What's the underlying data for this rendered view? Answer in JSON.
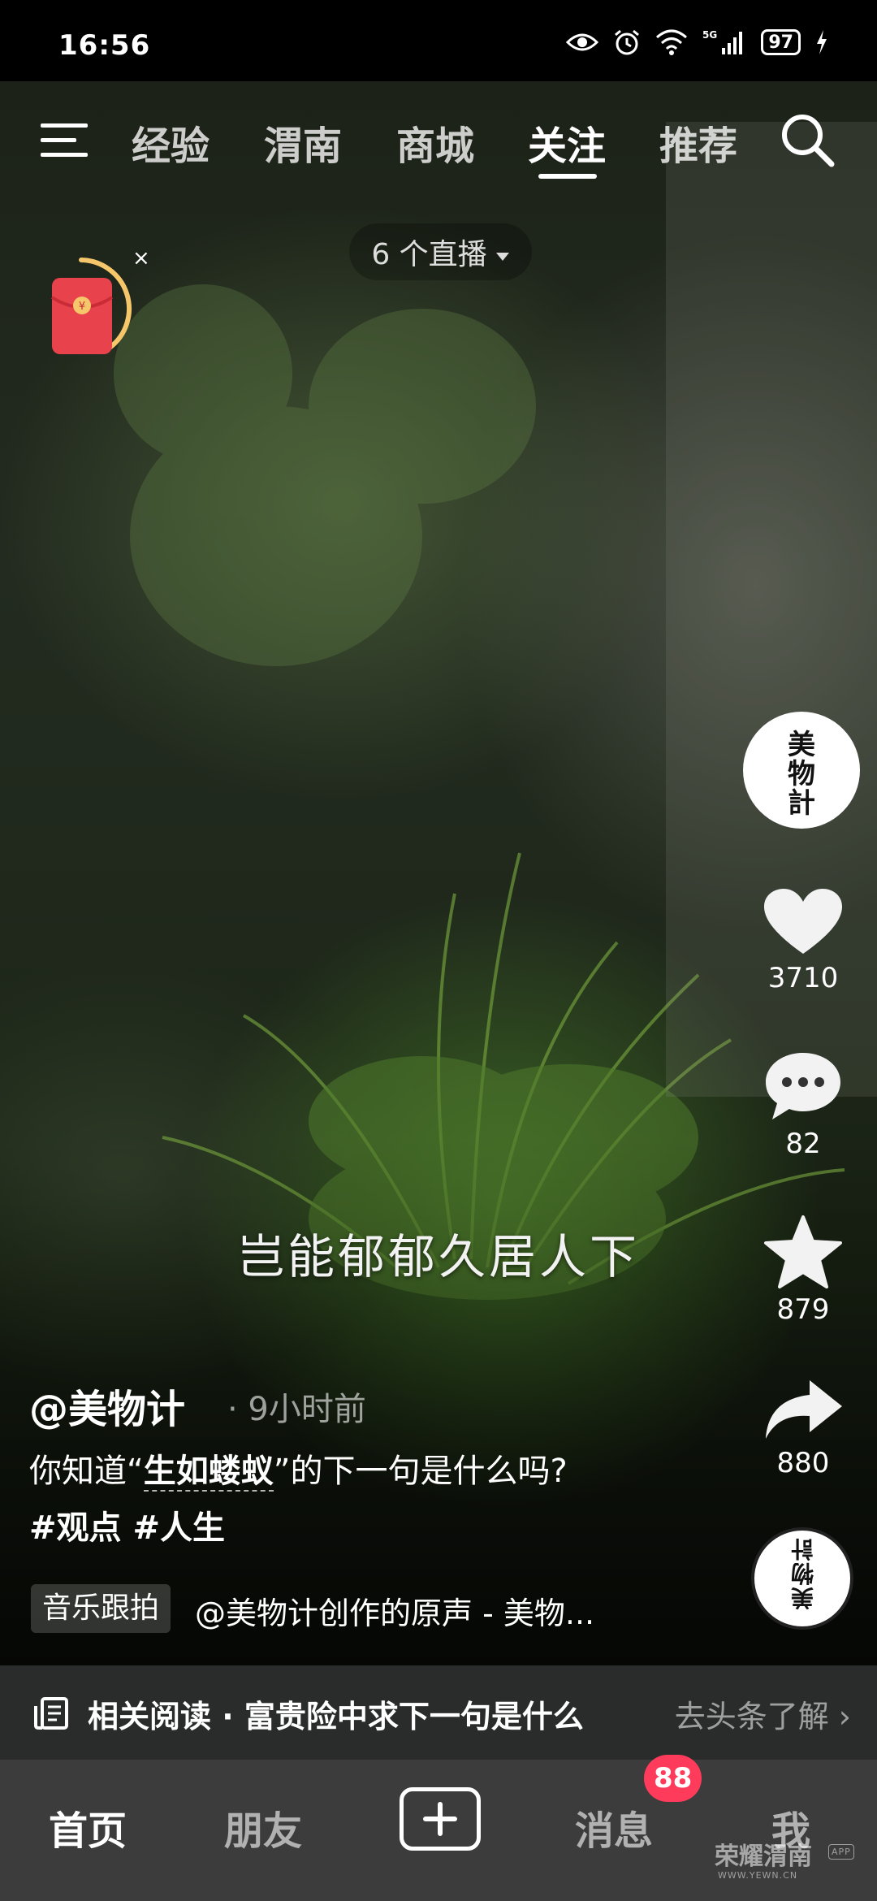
{
  "status_bar": {
    "time": "16:56",
    "network": "5G",
    "battery": "97",
    "icons": [
      "eye-icon",
      "alarm-icon",
      "wifi-icon",
      "signal-icon",
      "battery-icon",
      "charging-icon"
    ]
  },
  "top_nav": {
    "tabs": [
      {
        "label": "经验"
      },
      {
        "label": "渭南"
      },
      {
        "label": "商城"
      },
      {
        "label": "关注"
      },
      {
        "label": "推荐"
      }
    ],
    "active_tab": "关注",
    "live_pill": "6 个直播"
  },
  "video": {
    "subtitle": "岂能郁郁久居人下",
    "author": "@美物计",
    "time_ago": "· 9小时前",
    "description_prefix": "你知道“",
    "description_highlight": "生如蝼蚁",
    "description_suffix": "”的下一句是什么吗?",
    "tags": "#观点 #人生",
    "music_tag": "音乐跟拍",
    "music_name": "@美物计创作的原声 - 美物..."
  },
  "sidebar": {
    "avatar_text": "美物計",
    "likes": "3710",
    "comments": "82",
    "favorites": "879",
    "shares": "880"
  },
  "related": {
    "text": "相关阅读 · 富贵险中求下一句是什么",
    "link": "去头条了解"
  },
  "bottom_nav": {
    "home": "首页",
    "friends": "朋友",
    "messages": "消息",
    "messages_badge": "88",
    "me": "我"
  },
  "watermark": {
    "text": "荣耀渭南",
    "sub": "WWW.YEWN.CN",
    "app": "APP"
  },
  "colors": {
    "badge": "#ff3b5c",
    "red_packet": "#e8424c",
    "red_packet_ring": "#f5c76a"
  }
}
